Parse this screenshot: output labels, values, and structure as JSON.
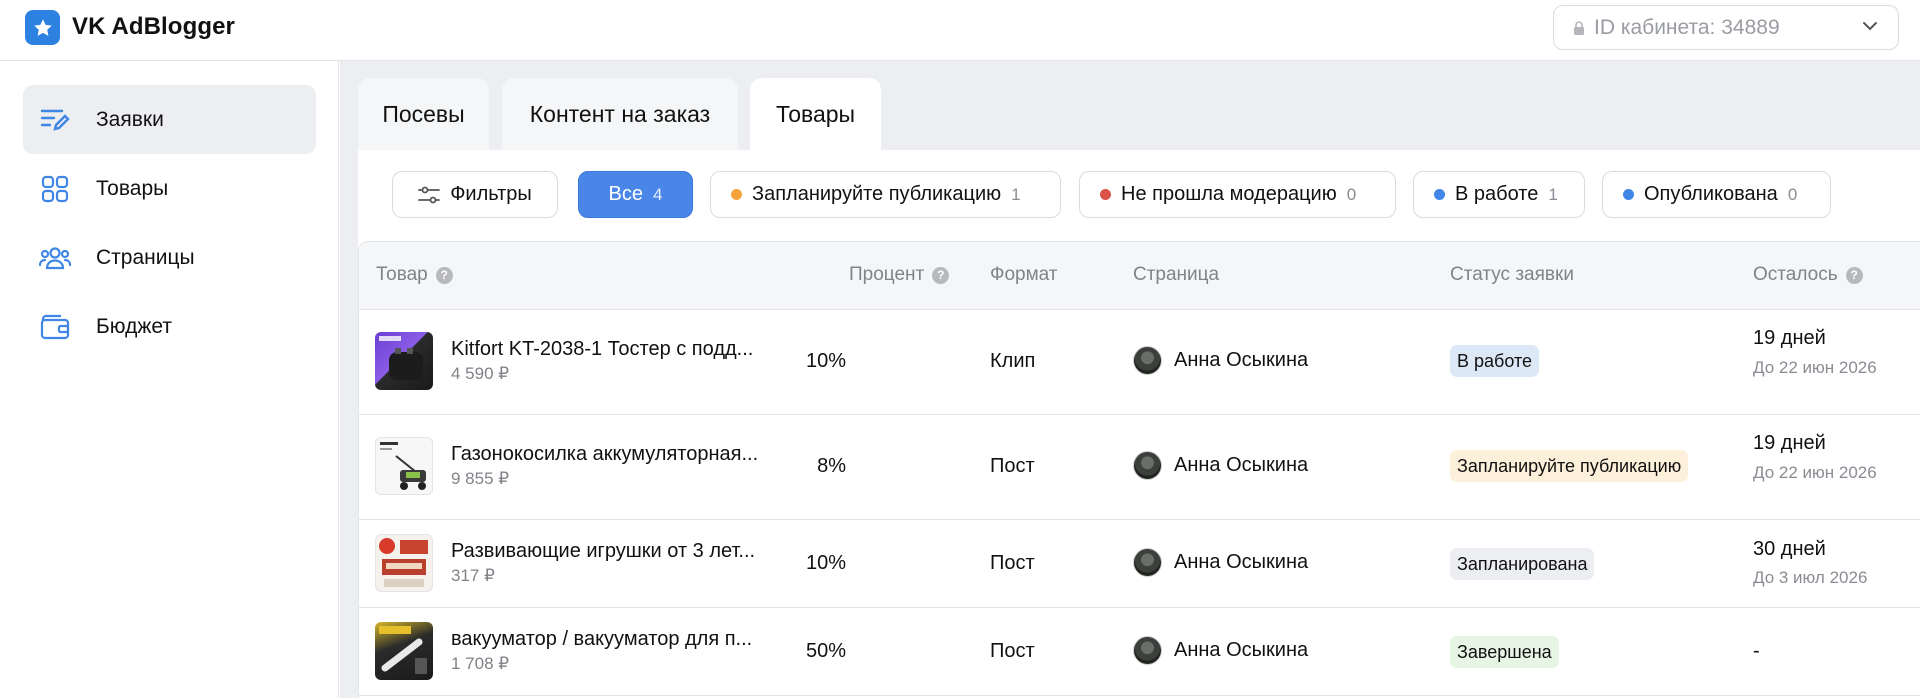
{
  "app": {
    "name": "VK AdBlogger"
  },
  "header": {
    "cabinet_select": "ID кабинета: 34889"
  },
  "sidebar": {
    "items": [
      {
        "label": "Заявки",
        "icon": "requests-edit-icon",
        "active": true
      },
      {
        "label": "Товары",
        "icon": "grid-icon",
        "active": false
      },
      {
        "label": "Страницы",
        "icon": "users-icon",
        "active": false
      },
      {
        "label": "Бюджет",
        "icon": "wallet-icon",
        "active": false
      }
    ]
  },
  "tabs": [
    {
      "label": "Посевы",
      "active": false
    },
    {
      "label": "Контент на заказ",
      "active": false
    },
    {
      "label": "Товары",
      "active": true
    }
  ],
  "filters": {
    "filters_label": "Фильтры",
    "chips": [
      {
        "label": "Все",
        "count": "4",
        "selected": true,
        "dot_color": ""
      },
      {
        "label": "Запланируйте публикацию",
        "count": "1",
        "selected": false,
        "dot_color": "#f4a43b"
      },
      {
        "label": "Не прошла модерацию",
        "count": "0",
        "selected": false,
        "dot_color": "#d9534a"
      },
      {
        "label": "В работе",
        "count": "1",
        "selected": false,
        "dot_color": "#3f86e6"
      },
      {
        "label": "Опубликована",
        "count": "0",
        "selected": false,
        "dot_color": "#3f86e6"
      }
    ]
  },
  "table": {
    "headers": {
      "product": "Товар",
      "percent": "Процент",
      "format": "Формат",
      "page": "Страница",
      "status": "Статус заявки",
      "remaining": "Осталось"
    },
    "rows": [
      {
        "name": "Kitfort KT-2038-1 Тостер с подд...",
        "price": "4 590 ₽",
        "percent": "10%",
        "format": "Клип",
        "page": "Анна Осыкина",
        "status": "В работе",
        "status_bg": "#dde8f7",
        "remaining": "19 дней",
        "deadline": "До 22 июн 2026"
      },
      {
        "name": "Газонокосилка аккумуляторная...",
        "price": "9 855 ₽",
        "percent": "8%",
        "format": "Пост",
        "page": "Анна Осыкина",
        "status": "Запланируйте публикацию",
        "status_bg": "#fdf0da",
        "remaining": "19 дней",
        "deadline": "До 22 июн 2026"
      },
      {
        "name": "Развивающие игрушки от 3 лет...",
        "price": "317 ₽",
        "percent": "10%",
        "format": "Пост",
        "page": "Анна Осыкина",
        "status": "Запланирована",
        "status_bg": "#eceef1",
        "remaining": "30 дней",
        "deadline": "До 3 июл 2026"
      },
      {
        "name": "вакууматор / вакууматор для п...",
        "price": "1 708 ₽",
        "percent": "50%",
        "format": "Пост",
        "page": "Анна Осыкина",
        "status": "Завершена",
        "status_bg": "#e6f5e4",
        "remaining": "-",
        "deadline": ""
      }
    ]
  },
  "colors": {
    "accent": "#4a86e8",
    "sidebar_active": "#eceef1",
    "main_bg": "#eceef1"
  }
}
